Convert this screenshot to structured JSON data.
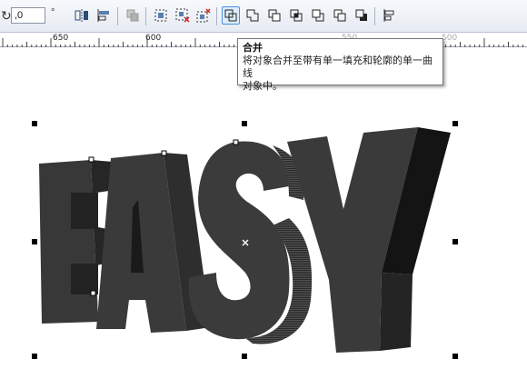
{
  "toolbar": {
    "angle_value": ",0",
    "angle_unit": "°",
    "buttons": [
      {
        "name": "mirror-horizontal-icon"
      },
      {
        "name": "align-distribute-icon"
      },
      {
        "name": "group-icon"
      },
      {
        "name": "ungroup-icon"
      },
      {
        "name": "ungroup-all-icon"
      },
      {
        "name": "combine-icon",
        "active": true
      },
      {
        "name": "weld-icon"
      },
      {
        "name": "trim-icon"
      },
      {
        "name": "intersect-icon"
      },
      {
        "name": "simplify-icon"
      },
      {
        "name": "front-minus-back-icon"
      },
      {
        "name": "back-minus-front-icon"
      },
      {
        "name": "align-left-icon"
      }
    ]
  },
  "ruler": {
    "labels": [
      "650",
      "600",
      "550",
      "500"
    ]
  },
  "tooltip": {
    "title": "合并",
    "line1": "将对象合并至带有单一填充和轮廓的单一曲线",
    "line2": "对象中。"
  },
  "canvas": {
    "artwork_text": "EASY",
    "colors": {
      "face": "#3a3a3a",
      "side": "#1d1d1d",
      "handle": "#000000"
    }
  }
}
